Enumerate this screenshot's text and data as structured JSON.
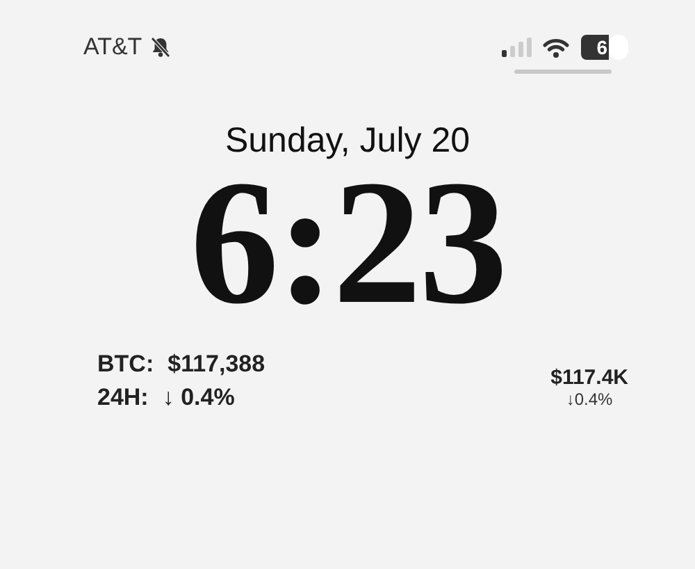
{
  "status_bar": {
    "carrier": "AT&T",
    "silent": true,
    "battery": "6"
  },
  "date": "Sunday, July 20",
  "time": "6:23",
  "widgets": {
    "left": [
      {
        "label": "BTC:",
        "value": "$117,388"
      },
      {
        "label": "24H:",
        "value": "↓ 0.4%"
      }
    ],
    "right": {
      "value": "$117.4K",
      "change": "↓0.4%"
    }
  }
}
